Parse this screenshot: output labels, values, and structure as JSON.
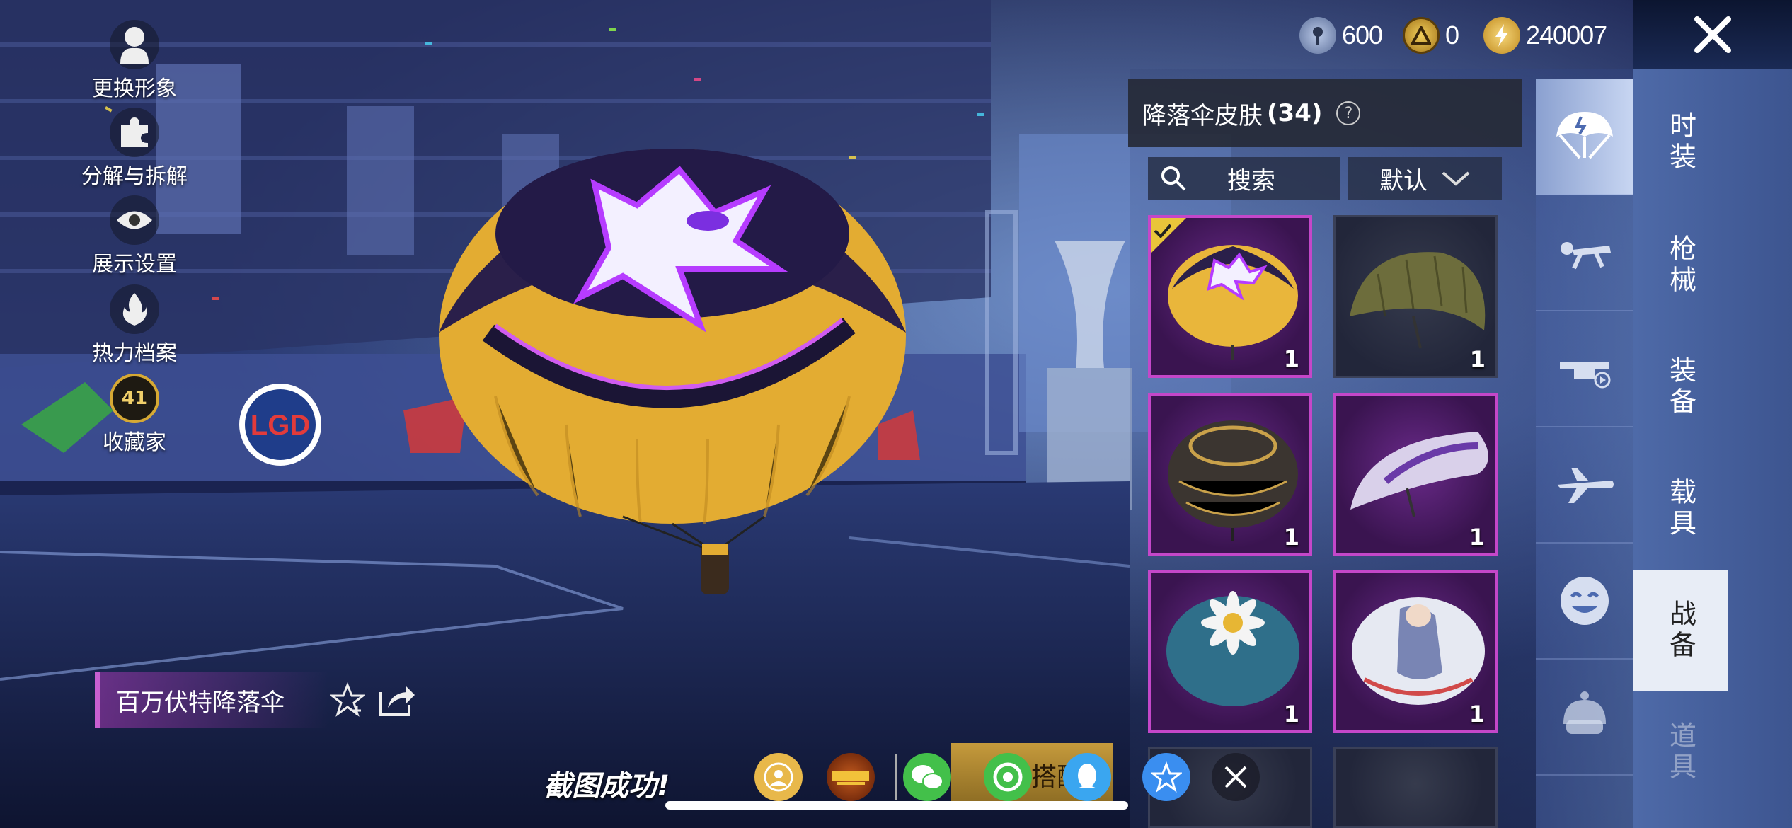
{
  "left_menu": [
    {
      "label": "更换形象",
      "icon": "avatar-icon"
    },
    {
      "label": "分解与拆解",
      "icon": "puzzle-icon"
    },
    {
      "label": "展示设置",
      "icon": "eye-icon"
    },
    {
      "label": "热力档案",
      "icon": "fire-icon"
    },
    {
      "label": "收藏家",
      "icon": "collector-badge-icon",
      "badge": "41"
    }
  ],
  "currencies": [
    {
      "icon": "silver-coin-icon",
      "amount": "600",
      "color": "#8fa3c8"
    },
    {
      "icon": "gold-token-icon",
      "amount": "0",
      "color": "#d8a835"
    },
    {
      "icon": "bolt-coin-icon",
      "amount": "240007",
      "color": "#e7b83a"
    }
  ],
  "panel": {
    "title": "降落伞皮肤",
    "count": "(34)",
    "help": "?",
    "search_label": "搜索",
    "sort_label": "默认"
  },
  "items": [
    {
      "name": "百万伏特降落伞",
      "qty": "1",
      "style": "purple",
      "equipped": true,
      "canopy": "#e9b63b"
    },
    {
      "name": "olive-parachute",
      "qty": "1",
      "style": "dark",
      "equipped": false,
      "canopy": "#6d6d3c"
    },
    {
      "name": "gold-black-parachute",
      "qty": "1",
      "style": "purple",
      "equipped": false,
      "canopy": "#3b3530"
    },
    {
      "name": "white-purple-parachute",
      "qty": "1",
      "style": "purple",
      "equipped": false,
      "canopy": "#d9d0ea"
    },
    {
      "name": "daisy-parachute",
      "qty": "1",
      "style": "purple",
      "equipped": false,
      "canopy": "#2f6f8a"
    },
    {
      "name": "anime-parachute",
      "qty": "1",
      "style": "purple",
      "equipped": false,
      "canopy": "#e6e9f2"
    }
  ],
  "icon_tabs": [
    {
      "icon": "parachute-icon",
      "active": true
    },
    {
      "icon": "skydiver-icon",
      "active": false
    },
    {
      "icon": "drone-icon",
      "active": false
    },
    {
      "icon": "airplane-icon",
      "active": false
    },
    {
      "icon": "emote-icon",
      "active": false
    },
    {
      "icon": "robot-icon",
      "active": false
    }
  ],
  "text_tabs": [
    {
      "label": "时装",
      "active": false
    },
    {
      "label": "枪械",
      "active": false
    },
    {
      "label": "装备",
      "active": false
    },
    {
      "label": "载具",
      "active": false
    },
    {
      "label": "战备",
      "active": true
    },
    {
      "label": "道具",
      "active": false
    }
  ],
  "selected_item": {
    "name": "百万伏特降落伞"
  },
  "bottom": {
    "screenshot_text": "截图成功!",
    "gold_button": "搭配",
    "share_icons": [
      "profile-share-icon",
      "game-logo-icon",
      "wechat-icon",
      "moments-icon",
      "qq-icon",
      "qzone-icon",
      "close-icon"
    ]
  },
  "colors": {
    "accent_purple": "#c447c9",
    "panel_dark": "#262a37",
    "tab_active": "#e8edf6"
  }
}
